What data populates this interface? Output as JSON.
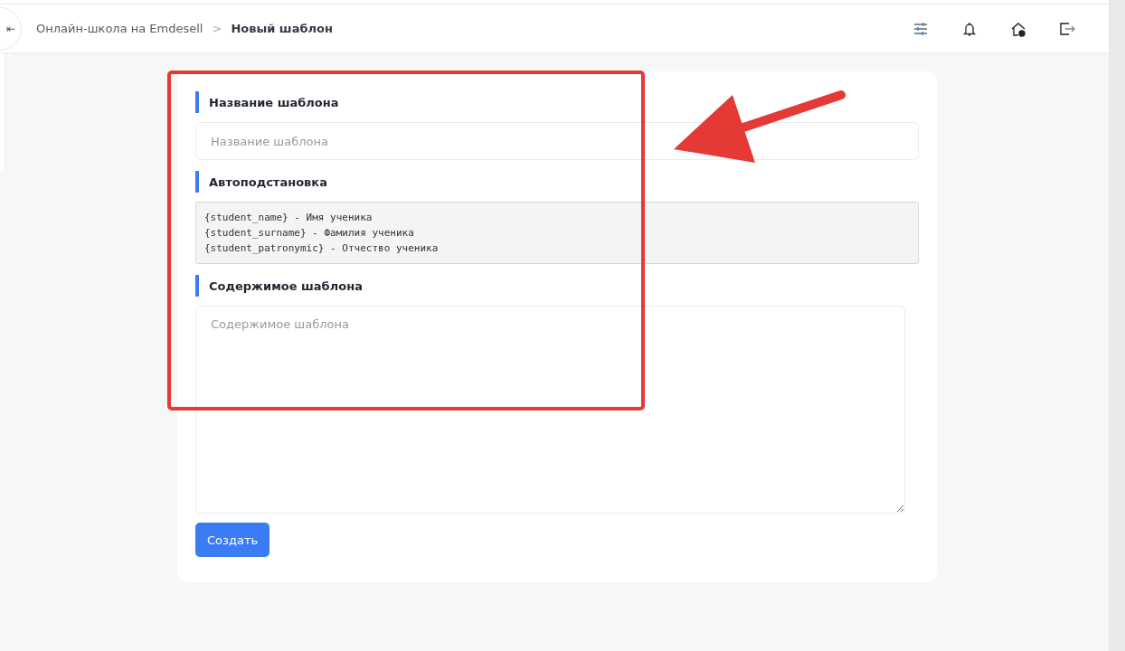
{
  "header": {
    "collapse_button": "⇤",
    "breadcrumbs": [
      {
        "label": "Онлайн-школа на Emdesell",
        "current": false
      },
      {
        "label": "Новый шаблон",
        "current": true
      }
    ],
    "separator": ">"
  },
  "form": {
    "fields": [
      {
        "kind": "input",
        "label": "Название шаблона",
        "placeholder": "Название шаблона"
      },
      {
        "kind": "code",
        "label": "Автоподстановка",
        "lines": [
          "{student_name} - Имя ученика",
          "{student_surname} - Фамилия ученика",
          "{student_patronymic} - Отчество ученика"
        ]
      },
      {
        "kind": "textarea",
        "label": "Содержимое шаблона",
        "placeholder": "Содержимое шаблона"
      }
    ],
    "submit": "Создать"
  }
}
